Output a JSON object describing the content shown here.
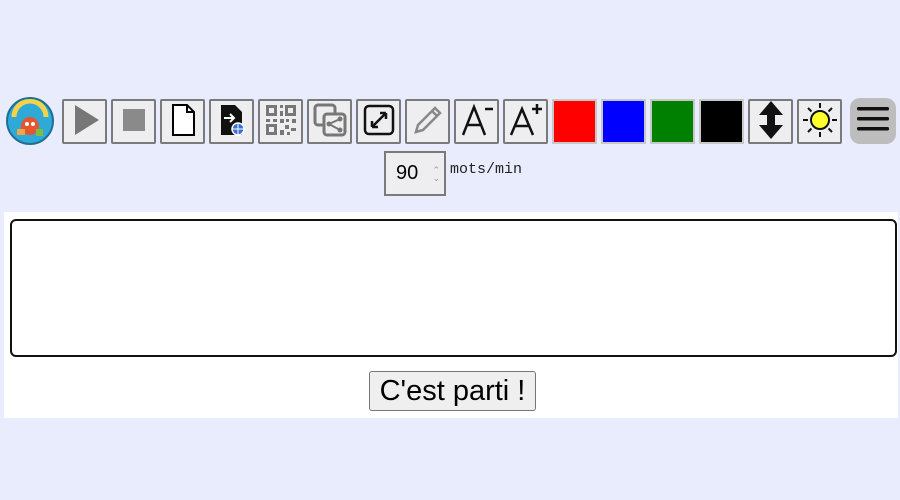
{
  "toolbar": {
    "logo": {
      "text": "Educajou",
      "icon": "educajou-logo"
    },
    "buttons": [
      {
        "name": "play-button",
        "icon": "play-icon"
      },
      {
        "name": "stop-button",
        "icon": "stop-icon"
      },
      {
        "name": "new-document-button",
        "icon": "new-document-icon"
      },
      {
        "name": "open-web-file-button",
        "icon": "web-file-icon"
      },
      {
        "name": "qr-code-button",
        "icon": "qr-code-icon"
      },
      {
        "name": "share-button",
        "icon": "share-icon"
      },
      {
        "name": "fullscreen-button",
        "icon": "fullscreen-icon"
      },
      {
        "name": "edit-button",
        "icon": "pencil-icon"
      },
      {
        "name": "font-decrease-button",
        "icon": "font-decrease-icon"
      },
      {
        "name": "font-increase-button",
        "icon": "font-increase-icon"
      }
    ],
    "colors": [
      "#ff0000",
      "#0000ff",
      "#008000",
      "#000000"
    ],
    "extra_buttons": [
      {
        "name": "vertical-scroll-button",
        "icon": "up-down-arrow-icon"
      },
      {
        "name": "brightness-button",
        "icon": "sun-icon"
      }
    ],
    "menu_icon": "hamburger-menu-icon"
  },
  "speed": {
    "value": "90",
    "unit": "mots/min"
  },
  "editor": {
    "text": "",
    "placeholder": ""
  },
  "start_button": {
    "label": "C'est parti !"
  }
}
